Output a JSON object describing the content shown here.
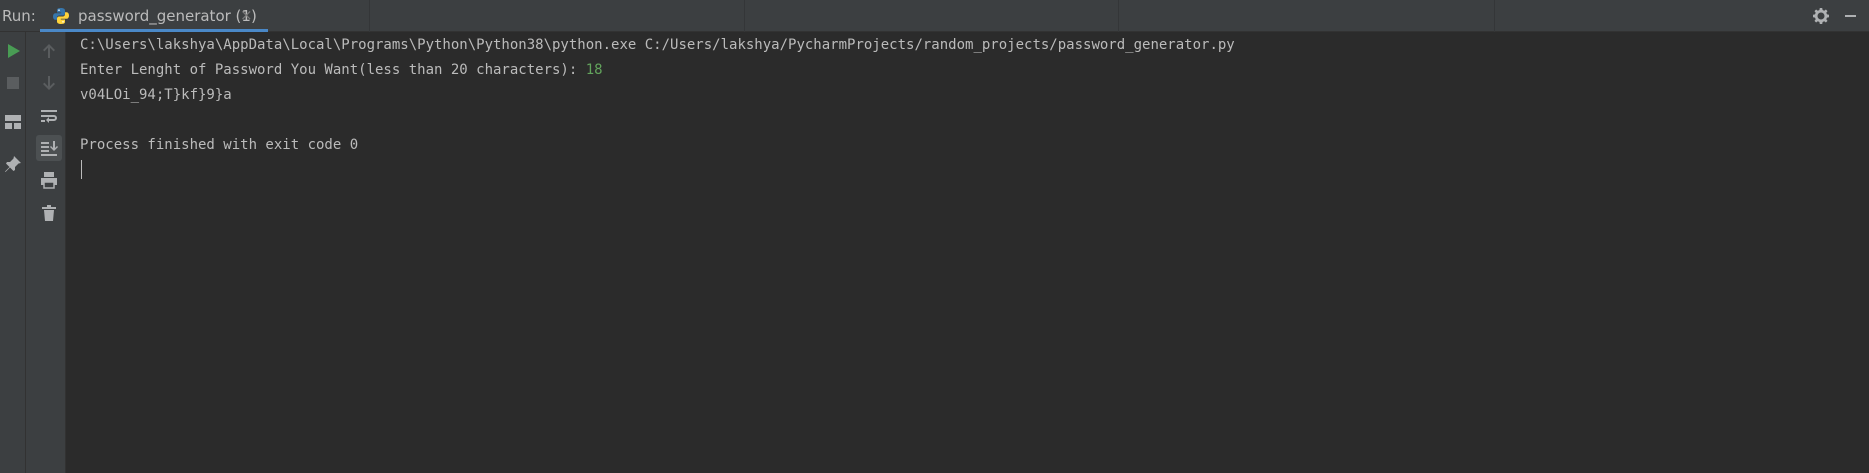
{
  "run_panel": {
    "label": "Run:",
    "tab": {
      "title": "password_generator (1)",
      "close_glyph": "×",
      "icon": "python-icon"
    }
  },
  "toolbar_left": [
    {
      "name": "rerun-icon",
      "color": "#499c54"
    },
    {
      "name": "stop-icon",
      "color": "#6e6e6e"
    },
    {
      "name": "layout-icon",
      "color": "#afb1b3"
    },
    {
      "name": "pin-icon",
      "color": "#afb1b3"
    }
  ],
  "toolbar_right": [
    {
      "name": "up-arrow-icon"
    },
    {
      "name": "down-arrow-icon"
    },
    {
      "name": "soft-wrap-icon"
    },
    {
      "name": "scroll-to-end-icon"
    },
    {
      "name": "print-icon"
    },
    {
      "name": "trash-icon"
    }
  ],
  "console": {
    "command": "C:\\Users\\lakshya\\AppData\\Local\\Programs\\Python\\Python38\\python.exe C:/Users/lakshya/PycharmProjects/random_projects/password_generator.py",
    "prompt": "Enter Lenght of Password You Want(less than 20 characters): ",
    "input_value": "18",
    "output": "v04LOi_94;T}kf}9}a",
    "exit_message": "Process finished with exit code 0"
  },
  "colors": {
    "background": "#2b2b2b",
    "panel": "#3c3f41",
    "accent": "#4a88c7",
    "input_green": "#62a35c"
  }
}
